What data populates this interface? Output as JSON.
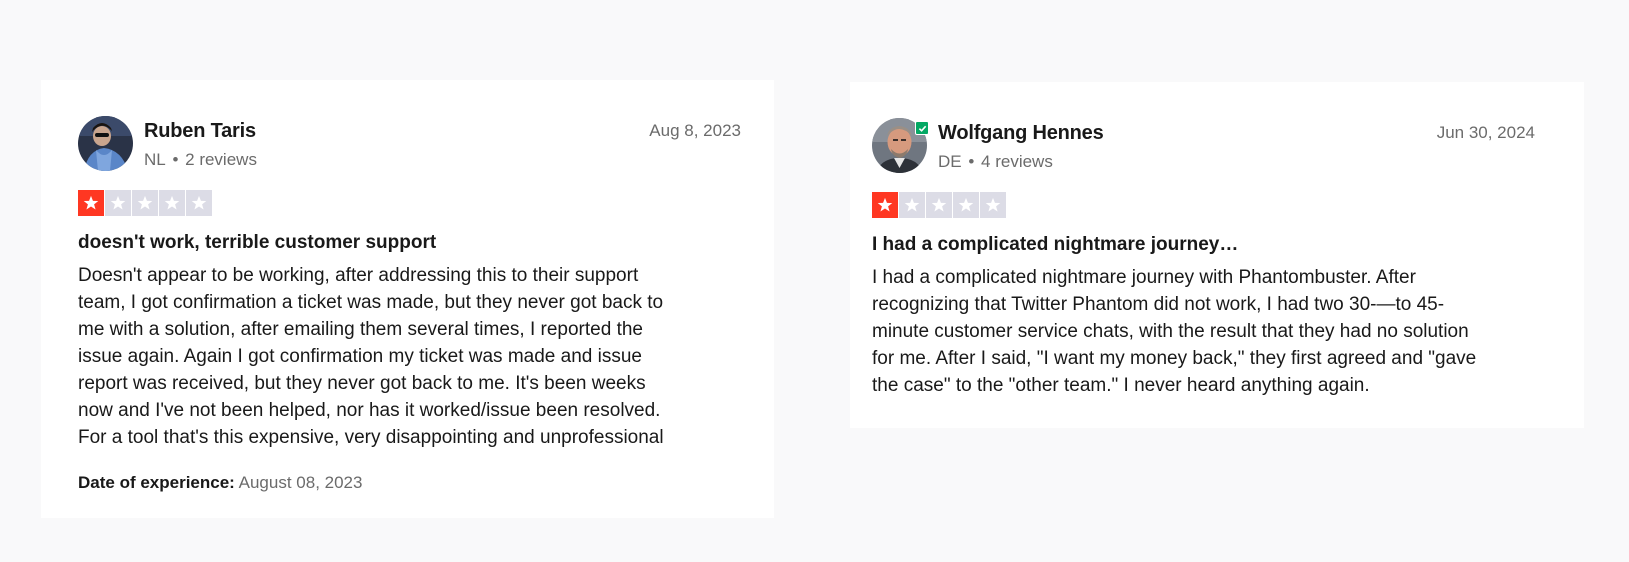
{
  "reviews": [
    {
      "name": "Ruben Taris",
      "country": "NL",
      "reviews_count": "2 reviews",
      "date": "Aug 8, 2023",
      "rating": 1,
      "rating_max": 5,
      "title": "doesn't work, terrible customer support",
      "body": "Doesn't appear to be working, after addressing this to their support\nteam, I got confirmation a ticket was made, but they never got back to\nme with a solution, after emailing them several times, I reported the\nissue again. Again I got confirmation my ticket was made and issue\nreport was received, but they never got back to me. It's been weeks\nnow and I've not been helped, nor has it worked/issue been resolved.\nFor a tool that's this expensive, very disappointing and unprofessional",
      "experience_label": "Date of experience:",
      "experience_date": "August 08, 2023"
    },
    {
      "name": "Wolfgang Hennes",
      "country": "DE",
      "reviews_count": "4 reviews",
      "date": "Jun 30, 2024",
      "rating": 1,
      "rating_max": 5,
      "verified": true,
      "title": "I had a complicated nightmare journey…",
      "body": "I had a complicated nightmare journey with Phantombuster. After\nrecognizing that Twitter Phantom did not work, I had two 30-—to 45-\nminute customer service chats, with the result that they had no solution\nfor me. After I said, \"I want my money back,\" they first agreed and \"gave\nthe case\" to the \"other team.\" I never heard anything again."
    }
  ],
  "colors": {
    "star_on": "#ff3722",
    "star_off": "#dcdce6",
    "verified": "#04a864",
    "background": "#f9f9fa",
    "card": "#ffffff"
  },
  "icons": {
    "star": "star-icon",
    "verified": "checkmark-icon"
  }
}
